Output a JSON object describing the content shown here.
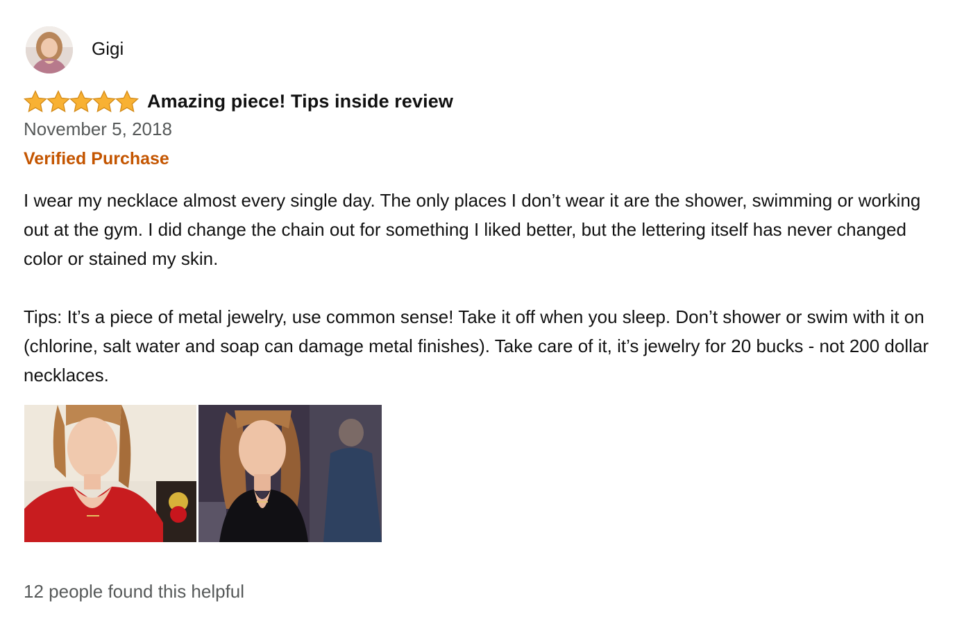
{
  "reviewer": {
    "name": "Gigi",
    "avatar_icon": "reviewer-avatar-photo"
  },
  "review": {
    "rating": 5,
    "rating_max": 5,
    "star_color": "#f5a623",
    "title": "Amazing piece! Tips inside review",
    "date": "November 5, 2018",
    "verified_label": "Verified Purchase",
    "verified_color": "#c45500",
    "paragraphs": [
      "I wear my necklace almost every single day. The only places I don’t wear it are the shower, swimming or working out at the gym. I did change the chain out for something I liked better, but the lettering itself has never changed color or stained my skin.",
      "Tips: It’s a piece of metal jewelry, use common sense! Take it off when you sleep. Don’t shower or swim with it on (chlorine, salt water and soap can damage metal finishes). Take care of it, it’s jewelry for 20 bucks - not 200 dollar necklaces."
    ],
    "photos": [
      {
        "icon": "review-photo-red-top"
      },
      {
        "icon": "review-photo-dark-top"
      }
    ],
    "helpful_text": "12 people found this helpful"
  }
}
